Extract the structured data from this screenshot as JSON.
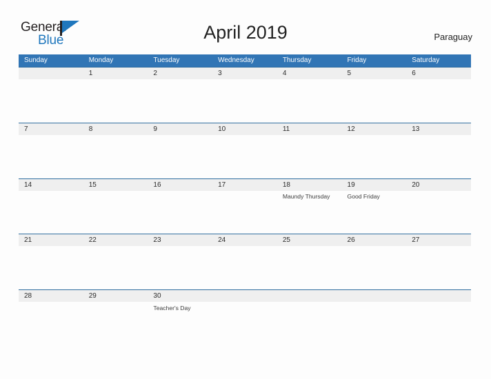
{
  "brand": {
    "word_one": "General",
    "word_two": "Blue",
    "flag_icon": "blue-pennant-flag-icon",
    "dark_color": "#231f20",
    "blue_color": "#1f77bd"
  },
  "header": {
    "title": "April 2019",
    "country": "Paraguay"
  },
  "theme": {
    "header_blue": "#3175b5",
    "row_divider_blue": "#2e6c9e",
    "date_band_gray": "#efefef",
    "page_background": "#fdfdfd",
    "text_dark": "#2b2b2b"
  },
  "calendar": {
    "month": "April",
    "year": "2019",
    "weekday_headers": [
      "Sunday",
      "Monday",
      "Tuesday",
      "Wednesday",
      "Thursday",
      "Friday",
      "Saturday"
    ],
    "weeks": [
      {
        "days": [
          {
            "date": "",
            "events": []
          },
          {
            "date": "1",
            "events": []
          },
          {
            "date": "2",
            "events": []
          },
          {
            "date": "3",
            "events": []
          },
          {
            "date": "4",
            "events": []
          },
          {
            "date": "5",
            "events": []
          },
          {
            "date": "6",
            "events": []
          }
        ]
      },
      {
        "days": [
          {
            "date": "7",
            "events": []
          },
          {
            "date": "8",
            "events": []
          },
          {
            "date": "9",
            "events": []
          },
          {
            "date": "10",
            "events": []
          },
          {
            "date": "11",
            "events": []
          },
          {
            "date": "12",
            "events": []
          },
          {
            "date": "13",
            "events": []
          }
        ]
      },
      {
        "days": [
          {
            "date": "14",
            "events": []
          },
          {
            "date": "15",
            "events": []
          },
          {
            "date": "16",
            "events": []
          },
          {
            "date": "17",
            "events": []
          },
          {
            "date": "18",
            "events": [
              "Maundy Thursday"
            ]
          },
          {
            "date": "19",
            "events": [
              "Good Friday"
            ]
          },
          {
            "date": "20",
            "events": []
          }
        ]
      },
      {
        "days": [
          {
            "date": "21",
            "events": []
          },
          {
            "date": "22",
            "events": []
          },
          {
            "date": "23",
            "events": []
          },
          {
            "date": "24",
            "events": []
          },
          {
            "date": "25",
            "events": []
          },
          {
            "date": "26",
            "events": []
          },
          {
            "date": "27",
            "events": []
          }
        ]
      },
      {
        "days": [
          {
            "date": "28",
            "events": []
          },
          {
            "date": "29",
            "events": []
          },
          {
            "date": "30",
            "events": [
              "Teacher's Day"
            ]
          },
          {
            "date": "",
            "events": []
          },
          {
            "date": "",
            "events": []
          },
          {
            "date": "",
            "events": []
          },
          {
            "date": "",
            "events": []
          }
        ]
      }
    ]
  }
}
